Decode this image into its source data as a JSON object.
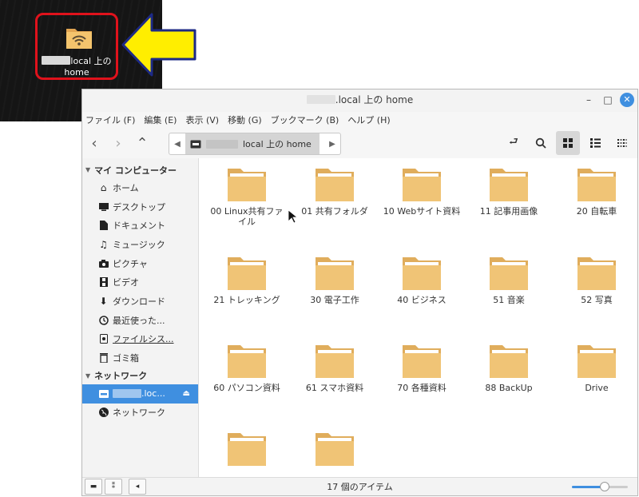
{
  "desktop": {
    "icon_label_line1": "local 上の",
    "icon_label_line2": "home",
    "icon": "network-folder-icon"
  },
  "window": {
    "title": ".local 上の home",
    "menu": [
      "ファイル (F)",
      "編集 (E)",
      "表示 (V)",
      "移動 (G)",
      "ブックマーク (B)",
      "ヘルプ (H)"
    ],
    "path_crumb": "local 上の home"
  },
  "sidebar": {
    "section_computer": "マイ コンピューター",
    "items": [
      {
        "label": "ホーム",
        "icon": "home-icon"
      },
      {
        "label": "デスクトップ",
        "icon": "desktop-icon"
      },
      {
        "label": "ドキュメント",
        "icon": "document-icon"
      },
      {
        "label": "ミュージック",
        "icon": "music-icon"
      },
      {
        "label": "ピクチャ",
        "icon": "camera-icon"
      },
      {
        "label": "ビデオ",
        "icon": "video-icon"
      },
      {
        "label": "ダウンロード",
        "icon": "download-icon"
      },
      {
        "label": "最近使った...",
        "icon": "clock-icon"
      },
      {
        "label": "ファイルシス...",
        "icon": "drive-icon"
      },
      {
        "label": "ゴミ箱",
        "icon": "trash-icon"
      }
    ],
    "section_network": "ネットワーク",
    "network_items": [
      {
        "label": ".loc...",
        "icon": "network-share-icon"
      },
      {
        "label": "ネットワーク",
        "icon": "globe-icon"
      }
    ]
  },
  "folders": [
    "00 Linux共有ファイル",
    "01 共有フォルダ",
    "10 Webサイト資料",
    "11 記事用画像",
    "20 自転車",
    "21 トレッキング",
    "30 電子工作",
    "40 ビジネス",
    "51 音楽",
    "52 写真",
    "60 パソコン資料",
    "61 スマホ資料",
    "70 各種資料",
    "88 BackUp",
    "Drive",
    "",
    ""
  ],
  "status": {
    "text": "17 個のアイテム",
    "zoom_level": 0.58
  },
  "colors": {
    "accent": "#3f8fe0",
    "folder": "#f0c476",
    "highlight": "#e0121c",
    "arrow": "#ffee00"
  }
}
